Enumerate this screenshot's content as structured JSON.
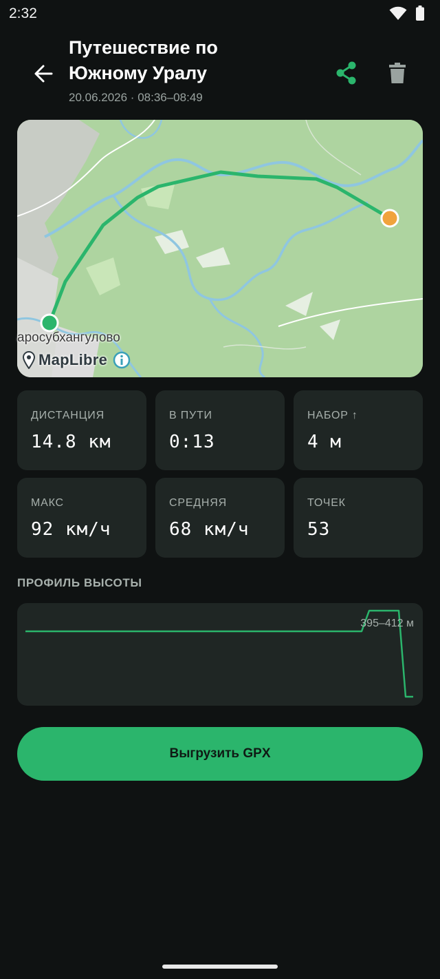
{
  "status_bar": {
    "time": "2:32",
    "icons": [
      "wifi-icon",
      "battery-icon"
    ]
  },
  "header": {
    "back_icon": "arrow-left-icon",
    "title": "Путешествие по Южному Уралу",
    "subtitle": "20.06.2026 · 08:36–08:49",
    "share_icon": "share-icon",
    "delete_icon": "trash-icon"
  },
  "map": {
    "place_label": "аросубхангулово",
    "attribution": "MapLibre",
    "track_color": "#2bb56c",
    "start_color": "#2bb56c",
    "end_color": "#f0a33c"
  },
  "stats": [
    {
      "label": "ДИСТАНЦИЯ",
      "value": "14.8 км"
    },
    {
      "label": "В ПУТИ",
      "value": "0:13"
    },
    {
      "label": "НАБОР ↑",
      "value": "4 м"
    },
    {
      "label": "МАКС",
      "value": "92 км/ч"
    },
    {
      "label": "СРЕДНЯЯ",
      "value": "68 км/ч"
    },
    {
      "label": "ТОЧЕК",
      "value": "53"
    }
  ],
  "elevation": {
    "section_title": "ПРОФИЛЬ ВЫСОТЫ",
    "range_label": "395–412 м",
    "line_color": "#2bb56c"
  },
  "export_button": {
    "label": "Выгрузить GPX"
  },
  "colors": {
    "background": "#0f1212",
    "card": "#1f2624",
    "accent": "#2bb56c"
  }
}
